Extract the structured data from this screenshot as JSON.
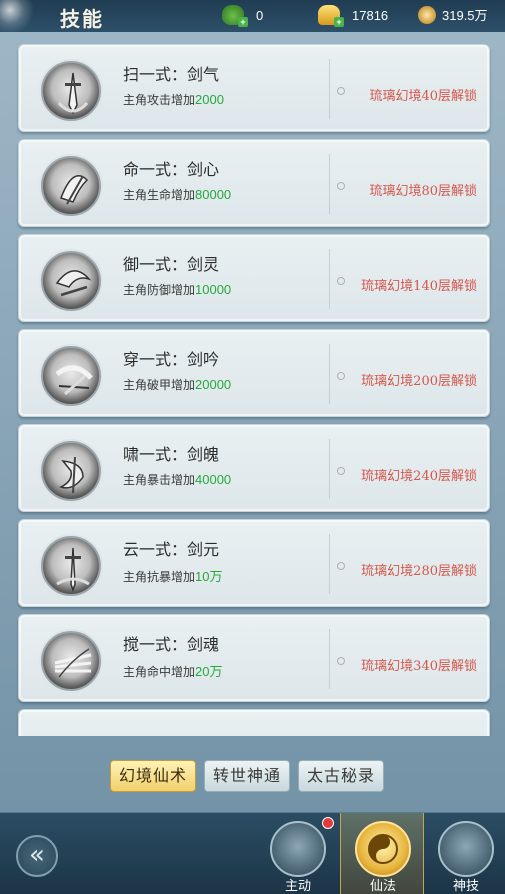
{
  "header": {
    "title": "技能",
    "currencies": [
      {
        "icon": "frog-coin-icon",
        "value": "0"
      },
      {
        "icon": "gold-ingot-icon",
        "value": "17816"
      },
      {
        "icon": "copper-coin-icon",
        "value": "319.5万"
      }
    ]
  },
  "skills": [
    {
      "name": "扫一式：剑气",
      "desc_prefix": "主角攻击增加",
      "value": "2000",
      "unlock": "琉璃幻境40层解锁"
    },
    {
      "name": "命一式：剑心",
      "desc_prefix": "主角生命增加",
      "value": "80000",
      "unlock": "琉璃幻境80层解锁"
    },
    {
      "name": "御一式：剑灵",
      "desc_prefix": "主角防御增加",
      "value": "10000",
      "unlock": "琉璃幻境140层解锁"
    },
    {
      "name": "穿一式：剑吟",
      "desc_prefix": "主角破甲增加",
      "value": "20000",
      "unlock": "琉璃幻境200层解锁"
    },
    {
      "name": "啸一式：剑魄",
      "desc_prefix": "主角暴击增加",
      "value": "40000",
      "unlock": "琉璃幻境240层解锁"
    },
    {
      "name": "云一式：剑元",
      "desc_prefix": "主角抗暴增加",
      "value": "10万",
      "unlock": "琉璃幻境280层解锁"
    },
    {
      "name": "搅一式：剑魂",
      "desc_prefix": "主角命中增加",
      "value": "20万",
      "unlock": "琉璃幻境340层解锁"
    }
  ],
  "tabs": [
    {
      "label": "幻境仙术",
      "active": true
    },
    {
      "label": "转世神通",
      "active": false
    },
    {
      "label": "太古秘录",
      "active": false
    }
  ],
  "nav": [
    {
      "label": "主动",
      "icon": "active-skill-icon",
      "badge": true
    },
    {
      "label": "仙法",
      "icon": "taiji-icon",
      "active": true
    },
    {
      "label": "神技",
      "icon": "divine-skill-icon"
    }
  ],
  "colors": {
    "value_green": "#27a83a",
    "unlock_red": "#d4574b",
    "active_tab": "#f1cf6c"
  }
}
